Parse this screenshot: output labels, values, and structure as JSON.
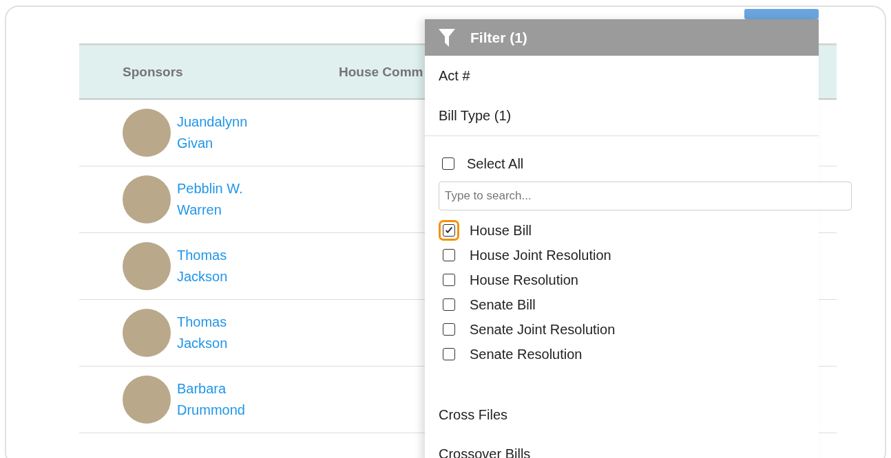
{
  "toolbar": {
    "button": {
      "kind": "search"
    }
  },
  "table": {
    "columns": [
      {
        "label": "Sponsors"
      },
      {
        "label": "House Comm"
      }
    ],
    "rows": [
      {
        "sponsor": "Juandalynn Givan"
      },
      {
        "sponsor": "Pebblin W. Warren"
      },
      {
        "sponsor": "Thomas Jackson"
      },
      {
        "sponsor": "Thomas Jackson"
      },
      {
        "sponsor": "Barbara Drummond"
      }
    ]
  },
  "filter": {
    "title": "Filter (1)",
    "sections": [
      {
        "label": "Act #"
      },
      {
        "label": "Bill Type (1)",
        "expanded": true
      }
    ],
    "select_all": {
      "label": "Select All",
      "checked": false
    },
    "search": {
      "placeholder": "Type to search..."
    },
    "options": [
      {
        "label": "House Bill",
        "checked": true,
        "focused": true
      },
      {
        "label": "House Joint Resolution",
        "checked": false,
        "focused": false
      },
      {
        "label": "House Resolution",
        "checked": false,
        "focused": false
      },
      {
        "label": "Senate Bill",
        "checked": false,
        "focused": false
      },
      {
        "label": "Senate Joint Resolution",
        "checked": false,
        "focused": false
      },
      {
        "label": "Senate Resolution",
        "checked": false,
        "focused": false
      }
    ],
    "more_sections": [
      {
        "label": "Cross Files"
      },
      {
        "label": "Crossover Bills"
      }
    ]
  }
}
